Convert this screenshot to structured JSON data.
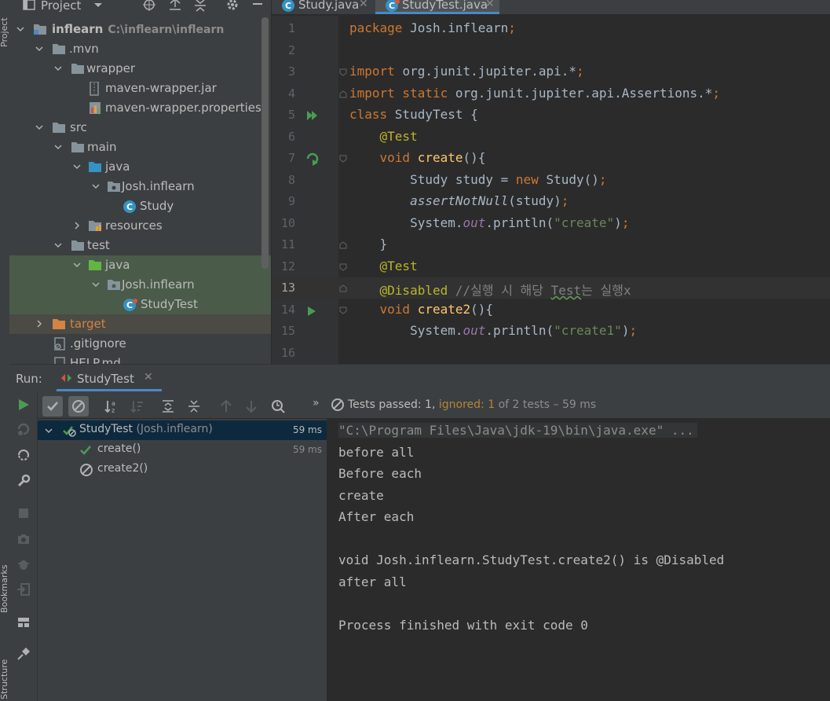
{
  "sidebar": {
    "project_label": "Project",
    "bookmarks_label": "Bookmarks",
    "structure_label": "Structure"
  },
  "project": {
    "title": "Project",
    "tree": [
      {
        "label": "inflearn",
        "path": "C:\\inflearn\\inflearn"
      },
      {
        "label": ".mvn"
      },
      {
        "label": "wrapper"
      },
      {
        "label": "maven-wrapper.jar"
      },
      {
        "label": "maven-wrapper.properties"
      },
      {
        "label": "src"
      },
      {
        "label": "main"
      },
      {
        "label": "java"
      },
      {
        "label": "Josh.inflearn"
      },
      {
        "label": "Study"
      },
      {
        "label": "resources"
      },
      {
        "label": "test"
      },
      {
        "label": "java"
      },
      {
        "label": "Josh.inflearn"
      },
      {
        "label": "StudyTest"
      },
      {
        "label": "target"
      },
      {
        "label": ".gitignore"
      },
      {
        "label": "HELP.md"
      }
    ]
  },
  "editor": {
    "tabs": [
      {
        "label": "Study.java",
        "active": false
      },
      {
        "label": "StudyTest.java",
        "active": true
      }
    ],
    "current_line": 13,
    "lines": [
      {
        "n": "1",
        "tokens": [
          {
            "t": "package ",
            "c": "kw"
          },
          {
            "t": "Josh.inflearn",
            "c": ""
          },
          {
            "t": ";",
            "c": "kw"
          }
        ]
      },
      {
        "n": "2",
        "tokens": []
      },
      {
        "n": "3",
        "tokens": [
          {
            "t": "import ",
            "c": "kw"
          },
          {
            "t": "org.junit.jupiter.api.*",
            "c": ""
          },
          {
            "t": ";",
            "c": "kw"
          }
        ]
      },
      {
        "n": "4",
        "tokens": [
          {
            "t": "import static ",
            "c": "kw"
          },
          {
            "t": "org.junit.jupiter.api.Assertions.*",
            "c": ""
          },
          {
            "t": ";",
            "c": "kw"
          }
        ]
      },
      {
        "n": "5",
        "tokens": [
          {
            "t": "class ",
            "c": "kw"
          },
          {
            "t": "StudyTest {",
            "c": ""
          }
        ]
      },
      {
        "n": "6",
        "tokens": [
          {
            "t": "    ",
            "c": ""
          },
          {
            "t": "@Test",
            "c": "an"
          }
        ]
      },
      {
        "n": "7",
        "tokens": [
          {
            "t": "    ",
            "c": ""
          },
          {
            "t": "void ",
            "c": "kw"
          },
          {
            "t": "create",
            "c": "fn"
          },
          {
            "t": "(){",
            "c": ""
          }
        ]
      },
      {
        "n": "8",
        "tokens": [
          {
            "t": "        Study study = ",
            "c": ""
          },
          {
            "t": "new ",
            "c": "kw"
          },
          {
            "t": "Study()",
            "c": ""
          },
          {
            "t": ";",
            "c": "kw"
          }
        ]
      },
      {
        "n": "9",
        "tokens": [
          {
            "t": "        ",
            "c": ""
          },
          {
            "t": "assertNotNull",
            "c": "it"
          },
          {
            "t": "(study)",
            "c": ""
          },
          {
            "t": ";",
            "c": "kw"
          }
        ]
      },
      {
        "n": "10",
        "tokens": [
          {
            "t": "        System.",
            "c": ""
          },
          {
            "t": "out",
            "c": "fld"
          },
          {
            "t": ".println(",
            "c": ""
          },
          {
            "t": "\"create\"",
            "c": "st"
          },
          {
            "t": ")",
            "c": ""
          },
          {
            "t": ";",
            "c": "kw"
          }
        ]
      },
      {
        "n": "11",
        "tokens": [
          {
            "t": "    }",
            "c": ""
          }
        ]
      },
      {
        "n": "12",
        "tokens": [
          {
            "t": "    ",
            "c": ""
          },
          {
            "t": "@Test",
            "c": "an"
          }
        ]
      },
      {
        "n": "13",
        "tokens": [
          {
            "t": "    ",
            "c": ""
          },
          {
            "t": "@Disabled",
            "c": "an"
          },
          {
            "t": " //실행 시 해당 ",
            "c": "cm"
          },
          {
            "t": "Test",
            "c": "cm ul-green"
          },
          {
            "t": "는 실행x",
            "c": "cm"
          }
        ]
      },
      {
        "n": "14",
        "tokens": [
          {
            "t": "    ",
            "c": ""
          },
          {
            "t": "void ",
            "c": "kw"
          },
          {
            "t": "create2",
            "c": "fn"
          },
          {
            "t": "(){",
            "c": ""
          }
        ]
      },
      {
        "n": "15",
        "tokens": [
          {
            "t": "        System.",
            "c": ""
          },
          {
            "t": "out",
            "c": "fld"
          },
          {
            "t": ".println(",
            "c": ""
          },
          {
            "t": "\"create1\"",
            "c": "st"
          },
          {
            "t": ")",
            "c": ""
          },
          {
            "t": ";",
            "c": "kw"
          }
        ]
      },
      {
        "n": "16",
        "tokens": []
      }
    ]
  },
  "run": {
    "label": "Run:",
    "tab_label": "StudyTest",
    "status": {
      "passed": "Tests passed: 1,",
      "ignored": "ignored: 1",
      "rest": "of 2 tests – 59 ms"
    },
    "results": [
      {
        "name": "StudyTest",
        "pkg": "(Josh.inflearn)",
        "time": "59 ms"
      },
      {
        "name": "create()",
        "time": "59 ms"
      },
      {
        "name": "create2()",
        "time": ""
      }
    ],
    "console": [
      "\"C:\\Program Files\\Java\\jdk-19\\bin\\java.exe\" ...",
      "before all",
      "Before each",
      "create",
      "After each",
      "",
      "void Josh.inflearn.StudyTest.create2() is @Disabled",
      "after all",
      "",
      "Process finished with exit code 0"
    ]
  },
  "colors": {
    "accent": "#4a88c7",
    "pass_green": "#499c54",
    "keyword": "#cc7832",
    "annotation": "#bbb529",
    "string": "#6a8759"
  },
  "icons": {
    "project_header": [
      "project-icon",
      "chevron-down-icon",
      "locate-icon",
      "expand-all-icon",
      "collapse-all-icon",
      "gear-icon",
      "minimize-icon"
    ],
    "run_side": [
      "rerun-icon",
      "rerun-failed-icon",
      "toggle-auto-test-icon",
      "wrench-icon",
      "stop-icon",
      "camera-icon",
      "debug-icon",
      "exit-icon",
      "layout-icon",
      "pin-icon"
    ],
    "run_toolbar": [
      "run-icon",
      "show-passed-icon",
      "show-ignored-icon",
      "sort-alpha-icon",
      "sort-duration-icon",
      "expand-all-icon",
      "collapse-all-icon",
      "previous-failed-icon",
      "next-failed-icon",
      "history-icon",
      "more-icon"
    ]
  }
}
